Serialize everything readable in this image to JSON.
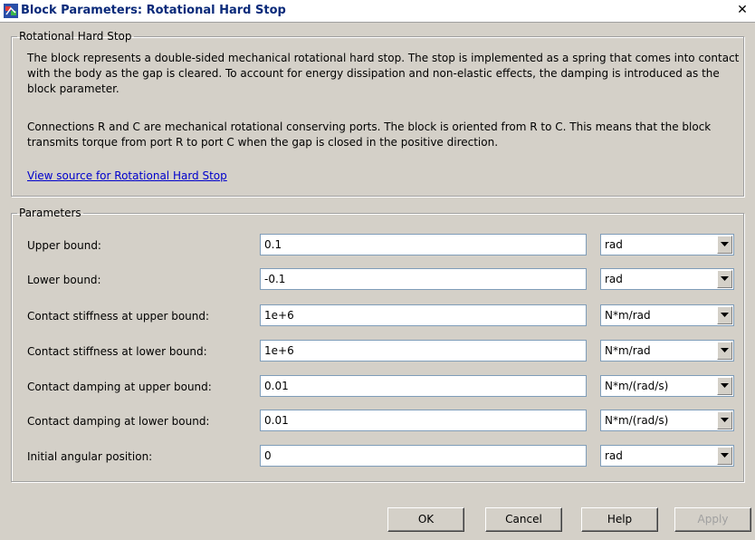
{
  "window": {
    "title": "Block Parameters: Rotational Hard Stop"
  },
  "block_group": {
    "legend": "Rotational Hard Stop",
    "description_1": "The block represents a double-sided mechanical rotational hard stop. The stop is implemented as a spring that comes into contact with the body as the gap is cleared. To account for energy dissipation and non-elastic effects, the damping is introduced as the block parameter.",
    "description_2": "Connections R and C are mechanical rotational conserving ports. The block is oriented from R to C. This means that the block transmits torque from port R to port C when the gap is closed in the positive direction.",
    "source_link": "View source for Rotational Hard Stop"
  },
  "parameters": {
    "legend": "Parameters",
    "rows": [
      {
        "label": "Upper bound:",
        "value": "0.1",
        "unit": "rad"
      },
      {
        "label": "Lower bound:",
        "value": "-0.1",
        "unit": "rad"
      },
      {
        "label": "Contact stiffness at upper bound:",
        "value": "1e+6",
        "unit": "N*m/rad"
      },
      {
        "label": "Contact stiffness at lower bound:",
        "value": "1e+6",
        "unit": "N*m/rad"
      },
      {
        "label": "Contact damping at upper bound:",
        "value": "0.01",
        "unit": "N*m/(rad/s)"
      },
      {
        "label": "Contact damping at lower bound:",
        "value": "0.01",
        "unit": "N*m/(rad/s)"
      },
      {
        "label": "Initial angular position:",
        "value": "0",
        "unit": "rad"
      }
    ]
  },
  "buttons": {
    "ok": "OK",
    "cancel": "Cancel",
    "help": "Help",
    "apply": "Apply"
  },
  "icons": {
    "app": "simulink-block-icon",
    "close": "close-icon",
    "dropdown": "chevron-down-icon"
  }
}
